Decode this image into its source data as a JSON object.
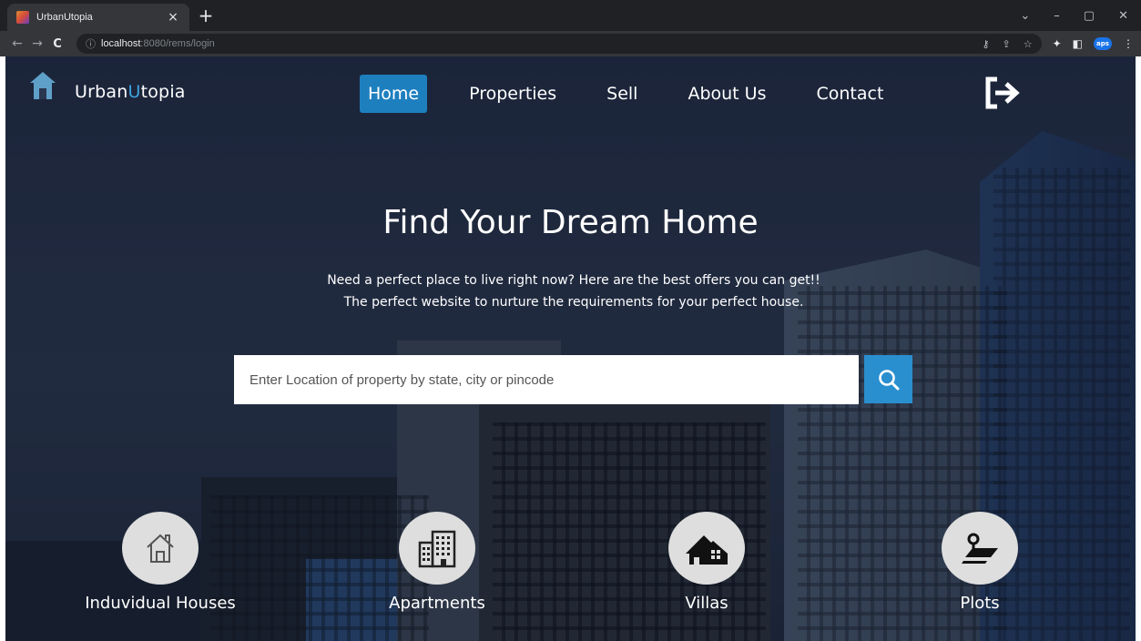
{
  "browser": {
    "tab_title": "UrbanUtopia",
    "tab_close": "×",
    "new_tab": "+",
    "url_host": "localhost",
    "url_rest": ":8080/rems/login",
    "profile_badge": "aps",
    "window_controls": [
      "⌄",
      "–",
      "▢",
      "✕"
    ]
  },
  "brand": {
    "name_part1": "Urban",
    "name_part2": "U",
    "name_part3": "topia"
  },
  "nav": {
    "items": [
      {
        "label": "Home",
        "active": true
      },
      {
        "label": "Properties"
      },
      {
        "label": "Sell"
      },
      {
        "label": "About Us"
      },
      {
        "label": "Contact"
      }
    ],
    "logout_icon": "logout-arrow-icon"
  },
  "hero": {
    "title": "Find Your Dream Home",
    "subtitle_line1": "Need a perfect place to live right now? Here are the best offers you can get!!",
    "subtitle_line2": "The perfect website to nurture the requirements for your perfect house.",
    "search_placeholder": "Enter Location of property by state, city or pincode"
  },
  "categories": [
    {
      "label": "Induvidual Houses",
      "icon": "house-outline-icon"
    },
    {
      "label": "Apartments",
      "icon": "apartment-building-icon"
    },
    {
      "label": "Villas",
      "icon": "villa-icon"
    },
    {
      "label": "Plots",
      "icon": "plot-pin-icon"
    }
  ],
  "colors": {
    "accent": "#1e7fbf",
    "search_button": "#2a8fcf",
    "brand_accent": "#3fa2e0"
  }
}
